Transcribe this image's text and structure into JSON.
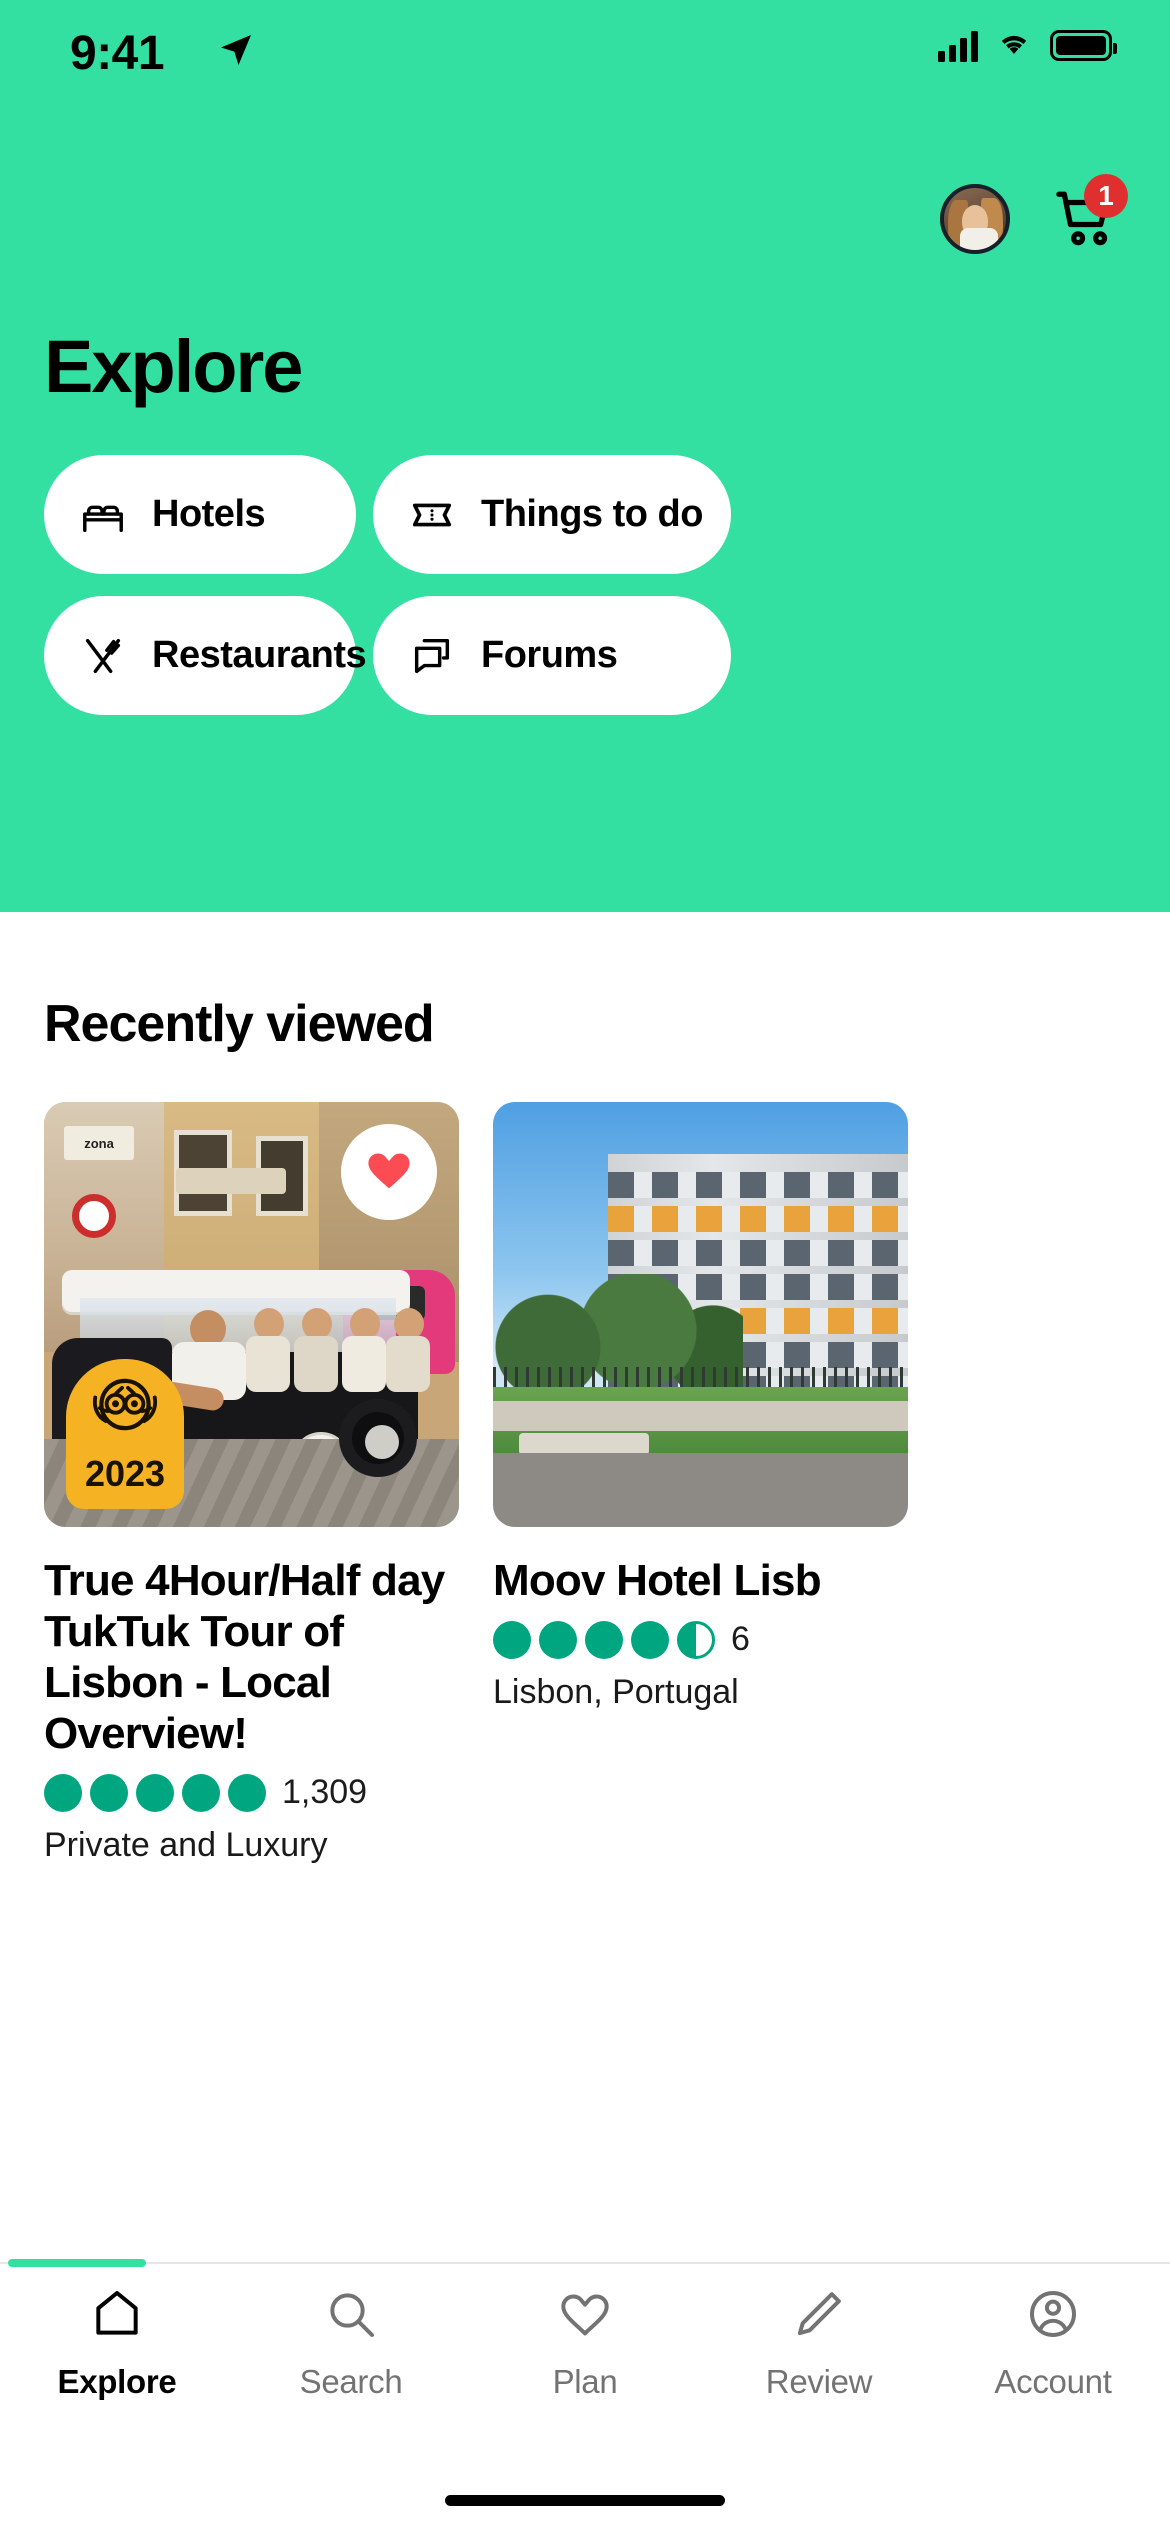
{
  "status_bar": {
    "time": "9:41",
    "location_icon": "location-arrow-icon",
    "signal_icon": "cellular-signal-icon",
    "wifi_icon": "wifi-icon",
    "battery_icon": "battery-icon"
  },
  "header": {
    "title": "Explore",
    "background_color": "#34E0A1",
    "avatar_name": "user-avatar",
    "cart": {
      "icon": "shopping-cart-icon",
      "badge_count": "1",
      "badge_color": "#E02F2F"
    }
  },
  "categories": [
    {
      "label": "Hotels",
      "icon": "bed-icon"
    },
    {
      "label": "Things to do",
      "icon": "ticket-icon"
    },
    {
      "label": "Restaurants",
      "icon": "fork-knife-icon"
    },
    {
      "label": "Forums",
      "icon": "chat-bubbles-icon"
    }
  ],
  "recently_viewed": {
    "section_title": "Recently viewed",
    "cards": [
      {
        "title": "True 4Hour/Half day TukTuk Tour of Lisbon - Local Overview!",
        "rating": 5,
        "review_count": "1,309",
        "subtitle": "Private and Luxury",
        "favorite": true,
        "favorite_icon": "heart-icon",
        "award_badge": {
          "year": "2023",
          "icon": "tripadvisor-owl-icon"
        }
      },
      {
        "title": "Moov Hotel Lisb",
        "rating": 4.5,
        "review_count": "6",
        "subtitle": "Lisbon, Portugal",
        "favorite": false
      }
    ]
  },
  "bottom_nav": {
    "active_index": 0,
    "accent_color": "#34E0A1",
    "items": [
      {
        "label": "Explore",
        "icon": "home-icon"
      },
      {
        "label": "Search",
        "icon": "search-icon"
      },
      {
        "label": "Plan",
        "icon": "heart-outline-icon"
      },
      {
        "label": "Review",
        "icon": "pencil-icon"
      },
      {
        "label": "Account",
        "icon": "account-circle-icon"
      }
    ]
  }
}
